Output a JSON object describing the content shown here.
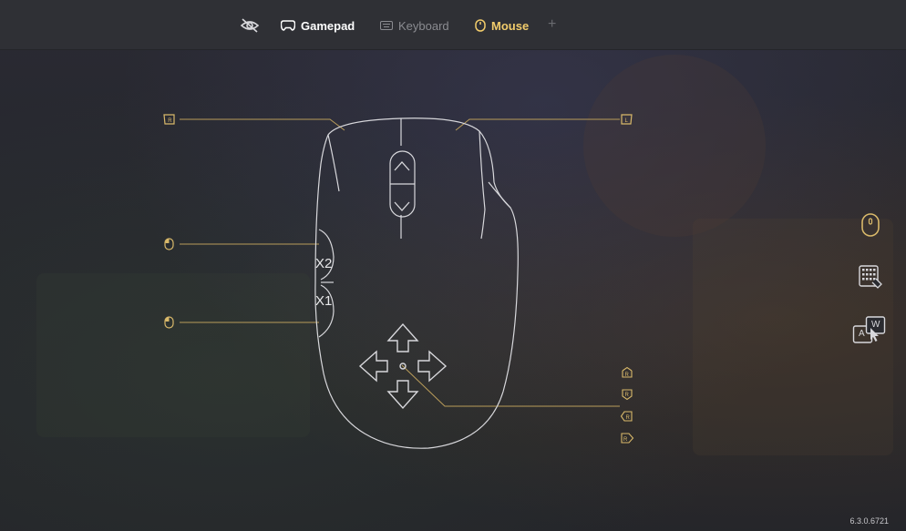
{
  "tabs": [
    {
      "label": "Gamepad",
      "icon": "gamepad-icon",
      "state": "active"
    },
    {
      "label": "Keyboard",
      "icon": "keyboard-icon",
      "state": "inactive"
    },
    {
      "label": "Mouse",
      "icon": "mouse-icon",
      "state": "selected"
    }
  ],
  "add_tab_glyph": "+",
  "mouse": {
    "side_buttons": {
      "x2": "X2",
      "x1": "X1"
    },
    "left_mappings": [
      {
        "id": "scroll-up",
        "icon": "right-bumper-icon",
        "text": "R"
      },
      {
        "id": "side-x2",
        "icon": "mouse-click-icon"
      },
      {
        "id": "side-x1",
        "icon": "mouse-click-icon"
      }
    ],
    "right_mappings": [
      {
        "id": "left-bumper",
        "icon": "left-bumper-icon",
        "text": "L"
      },
      {
        "id": "rs-up",
        "icon": "right-stick-up-icon",
        "text": "R"
      },
      {
        "id": "rs-down",
        "icon": "right-stick-down-icon",
        "text": "R"
      },
      {
        "id": "rs-left",
        "icon": "right-stick-left-icon",
        "text": "R"
      },
      {
        "id": "rs-right",
        "icon": "right-stick-right-icon",
        "text": "R"
      }
    ]
  },
  "side_panel": [
    {
      "icon": "mouse-mode-icon",
      "active": true
    },
    {
      "icon": "keyboard-mode-icon",
      "active": false
    },
    {
      "icon": "key-hint-icon",
      "keys": [
        "A",
        "W"
      ],
      "active": false
    }
  ],
  "version": "6.3.0.6721",
  "colors": {
    "accent": "#d9b96a",
    "active_tab": "#f2cc6b",
    "line": "#b99c5a",
    "outline": "#d8d8dc"
  }
}
